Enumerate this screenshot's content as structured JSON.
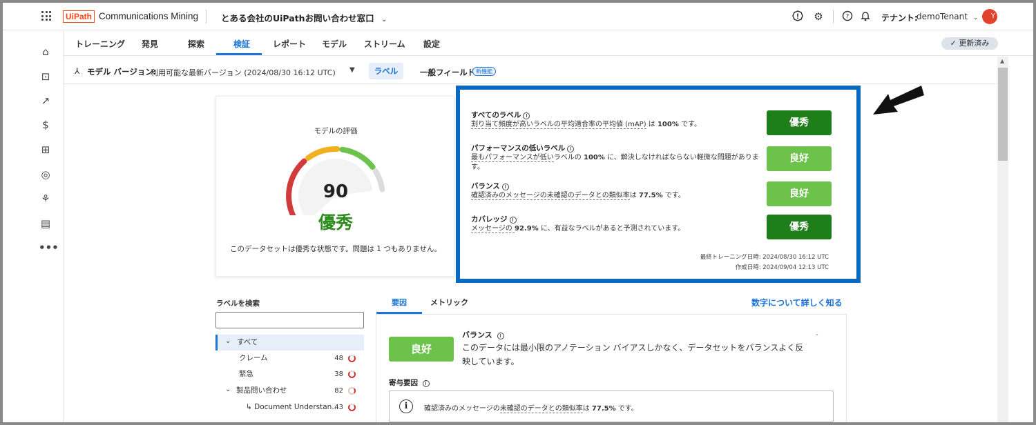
{
  "header": {
    "logo_text": "UiPath",
    "product": "Communications Mining",
    "dataset": "とある会社のUiPathお問い合わせ窓口",
    "tenant_label": "テナント:",
    "tenant_name": "demoTenant",
    "avatar_initial": "Y"
  },
  "tabs": [
    {
      "label": "トレーニング"
    },
    {
      "label": "発見"
    },
    {
      "label": "探索"
    },
    {
      "label": "検証"
    },
    {
      "label": "レポート"
    },
    {
      "label": "モデル"
    },
    {
      "label": "ストリーム"
    },
    {
      "label": "設定"
    }
  ],
  "active_tab": "検証",
  "updated_badge": "✓ 更新済み",
  "model_row": {
    "label": "モデル バージョン:",
    "value": "利用可能な最新バージョン (2024/08/30 16:12 UTC)",
    "label_button": "ラベル",
    "general_fields": "一般フィールド",
    "new_badge": "新機能"
  },
  "evaluation": {
    "title": "モデルの評価",
    "score": "90",
    "grade": "優秀",
    "description": "このデータセットは優秀な状態です。問題は 1 つもありません。",
    "score_value": 90,
    "colors": [
      "#d13b3b",
      "#f2b01e",
      "#6cc24a",
      "#dcdcdc"
    ]
  },
  "metrics": [
    {
      "title": "すべてのラベル",
      "desc_pre": "割り当て頻度が高いラベルの平均適合率の平均値 (mAP)",
      "desc_mid": " は ",
      "desc_bold": "100%",
      "desc_post": " です。",
      "rating": "優秀",
      "level": "exc"
    },
    {
      "title": "パフォーマンスの低いラベル",
      "desc_pre": "最もパフォーマンスが低い",
      "desc_mid": "ラベルの ",
      "desc_bold": "100%",
      "desc_post": " に、解決しなければならない軽微な問題があります。",
      "rating": "良好",
      "level": "good"
    },
    {
      "title": "バランス",
      "desc_pre": "確認済みのメッセージの未確認のデータとの類似率",
      "desc_mid": "は ",
      "desc_bold": "77.5%",
      "desc_post": " です。",
      "rating": "良好",
      "level": "good"
    },
    {
      "title": "カバレッジ",
      "desc_pre": "メッセージの ",
      "desc_mid": "",
      "desc_bold": "92.9%",
      "desc_post": " に、有益なラベルがあると予測されています。",
      "rating": "優秀",
      "level": "exc"
    }
  ],
  "footer": {
    "last_training": "最終トレーニング日時: 2024/08/30 16:12 UTC",
    "created": "作成日時: 2024/09/04 12:13 UTC"
  },
  "label_search": {
    "title": "ラベルを検索",
    "placeholder": ""
  },
  "tree": [
    {
      "label": "すべて",
      "count": "",
      "indent": 0,
      "caret": "⌄",
      "selected": true
    },
    {
      "label": "クレーム",
      "count": "48",
      "indent": 1,
      "caret": "",
      "selected": false
    },
    {
      "label": "緊急",
      "count": "38",
      "indent": 1,
      "caret": "",
      "selected": false
    },
    {
      "label": "製品問い合わせ",
      "count": "82",
      "indent": 0,
      "caret": "⌄",
      "selected": false
    },
    {
      "label": "↳ Document Understan...",
      "count": "43",
      "indent": 2,
      "caret": "",
      "selected": false
    }
  ],
  "bottom_tabs": [
    {
      "label": "要因"
    },
    {
      "label": "メトリック"
    }
  ],
  "learn_more": "数字について詳しく知る",
  "detail": {
    "rating": "良好",
    "title": "バランス",
    "text": "このデータには最小限のアノテーション バイアスしかなく、データセットをバランスよく反映しています。",
    "contributing_title": "寄与要因",
    "contributing_pre": "確認済みのメッセージの",
    "contributing_link": "未確認のデータとの類似率",
    "contributing_mid": "は ",
    "contributing_bold": "77.5%",
    "contributing_post": " です。"
  }
}
